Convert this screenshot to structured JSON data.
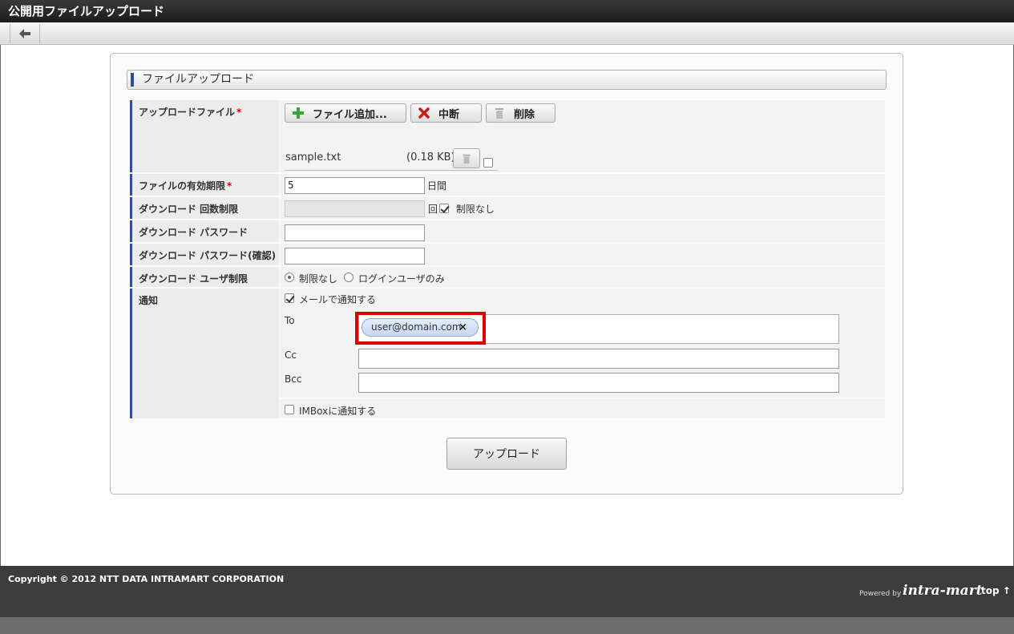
{
  "window": {
    "title": "公開用ファイルアップロード"
  },
  "section": {
    "title": "ファイルアップロード"
  },
  "upload_file": {
    "label": "アップロードファイル",
    "required_mark": "*",
    "add_button": "ファイル追加...",
    "cancel_button": "中断",
    "delete_button": "削除",
    "file_name": "sample.txt",
    "file_size": "(0.18 KB)"
  },
  "expiry": {
    "label": "ファイルの有効期限",
    "required_mark": "*",
    "value": "5",
    "unit": "日間"
  },
  "download_count": {
    "label": "ダウンロード 回数制限",
    "value": "",
    "unit": "回",
    "unlimited_label": "制限なし",
    "unlimited_checked": true
  },
  "download_password": {
    "label": "ダウンロード パスワード",
    "value": ""
  },
  "download_password_confirm": {
    "label": "ダウンロード パスワード(確認)",
    "value": ""
  },
  "download_user": {
    "label": "ダウンロード ユーザ制限",
    "option_none": "制限なし",
    "option_login": "ログインユーザのみ",
    "selected": "none"
  },
  "notify": {
    "label": "通知",
    "mail_label": "メールで通知する",
    "mail_checked": true,
    "to_label": "To",
    "to_chip": "user@domain.com",
    "chip_remove": "×",
    "cc_label": "Cc",
    "bcc_label": "Bcc",
    "imbox_label": "IMBoxに通知する",
    "imbox_checked": false
  },
  "upload_button": "アップロード",
  "footer": {
    "copyright": "Copyright © 2012 NTT DATA INTRAMART CORPORATION",
    "powered_by": "Powered by",
    "brand": "intra-mart",
    "top_link": "top ↑"
  }
}
